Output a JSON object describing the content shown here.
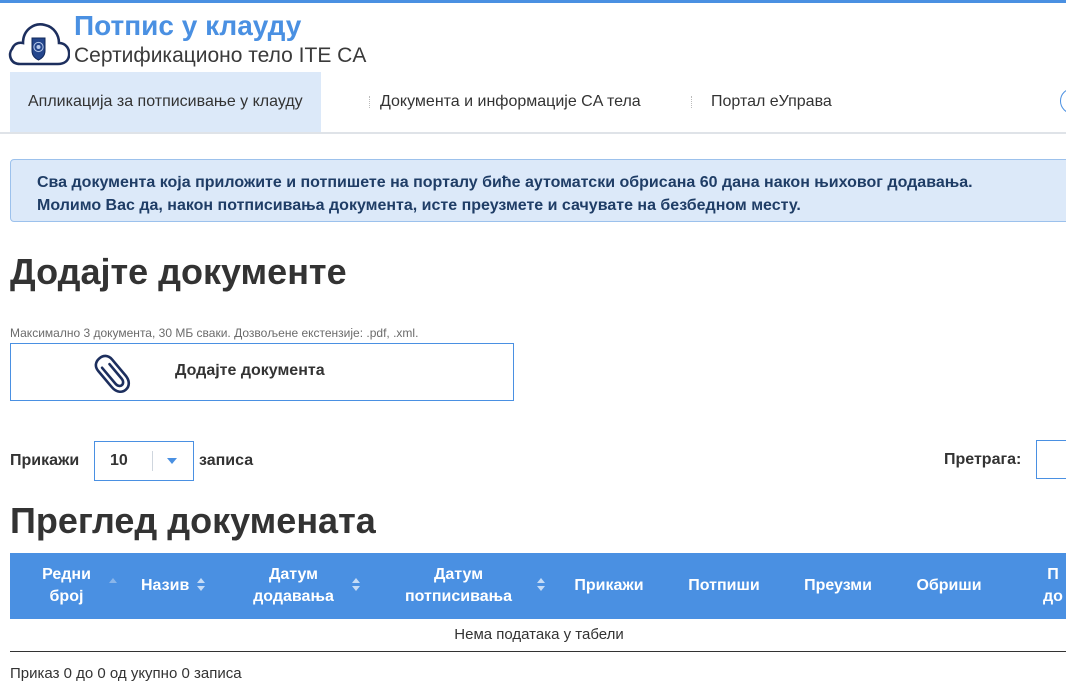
{
  "header": {
    "title": "Потпис у клауду",
    "subtitle": "Сертификационо тело ITE CA",
    "logo_icon": "cloud-shield-logo-icon"
  },
  "nav": {
    "items": [
      {
        "label": "Апликација за потписивање у клауду",
        "active": true
      },
      {
        "label": "Документа и информације CA тела",
        "active": false
      },
      {
        "label": "Портал еУправа",
        "active": false
      }
    ]
  },
  "alert": {
    "line1": "Сва документа која приложите и потпишете на порталу биће аутоматски обрисана 60 дана након њиховог додавања.",
    "line2": "Молимо Вас да, након потписивања документа, исте преузмете и сачувате на безбедном месту."
  },
  "upload_section": {
    "heading": "Додајте документе",
    "hint": "Максимално 3 документа, 30 МБ сваки. Дозвољене екстензије: .pdf, .xml.",
    "button_label": "Додајте документа",
    "icon": "paperclip-icon"
  },
  "controls": {
    "show_label": "Прикажи",
    "page_size": "10",
    "records_label": "записа",
    "search_label": "Претрага:",
    "search_value": ""
  },
  "table": {
    "heading": "Преглед докумената",
    "columns": [
      {
        "line1": "Редни",
        "line2": "број"
      },
      {
        "line1": "Назив",
        "line2": ""
      },
      {
        "line1": "Датум",
        "line2": "додавања"
      },
      {
        "line1": "Датум",
        "line2": "потписивања"
      },
      {
        "line1": "Прикажи",
        "line2": ""
      },
      {
        "line1": "Потпиши",
        "line2": ""
      },
      {
        "line1": "Преузми",
        "line2": ""
      },
      {
        "line1": "Обриши",
        "line2": ""
      },
      {
        "line1": "П",
        "line2": "до"
      }
    ],
    "empty_text": "Нема података у табели",
    "info_text": "Приказ 0 до 0 од укупно 0 записа"
  },
  "colors": {
    "accent": "#4a90e2",
    "alert_bg": "#dce9f9",
    "alert_text": "#1f3d66",
    "nav_active_bg": "#dce9f9"
  }
}
